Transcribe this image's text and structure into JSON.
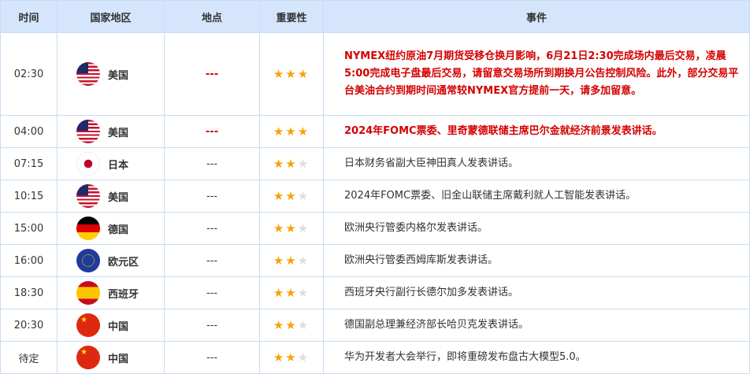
{
  "headers": [
    "时间",
    "国家地区",
    "地点",
    "重要性",
    "事件"
  ],
  "rows": [
    {
      "time": "02:30",
      "country": "美国",
      "flag": "us",
      "location": "---",
      "stars": 3,
      "important": true,
      "event": "NYMEX纽约原油7月期货受移仓换月影响，6月21日2:30完成场内最后交易，凌晨5:00完成电子盘最后交易，请留意交易场所到期换月公告控制风险。此外，部分交易平台美油合约到期时间通常较NYMEX官方提前一天，请多加留意。"
    },
    {
      "time": "04:00",
      "country": "美国",
      "flag": "us",
      "location": "---",
      "stars": 3,
      "important": true,
      "event": "2024年FOMC票委、里奇蒙德联储主席巴尔金就经济前景发表讲话。"
    },
    {
      "time": "07:15",
      "country": "日本",
      "flag": "jp",
      "location": "---",
      "stars": 2,
      "important": false,
      "event": "日本财务省副大臣神田真人发表讲话。"
    },
    {
      "time": "10:15",
      "country": "美国",
      "flag": "us",
      "location": "---",
      "stars": 2,
      "important": false,
      "event": "2024年FOMC票委、旧金山联储主席戴利就人工智能发表讲话。"
    },
    {
      "time": "15:00",
      "country": "德国",
      "flag": "de",
      "location": "---",
      "stars": 2,
      "important": false,
      "event": "欧洲央行管委内格尔发表讲话。"
    },
    {
      "time": "16:00",
      "country": "欧元区",
      "flag": "eu",
      "location": "---",
      "stars": 2,
      "important": false,
      "event": "欧洲央行管委西姆库斯发表讲话。"
    },
    {
      "time": "18:30",
      "country": "西班牙",
      "flag": "es",
      "location": "---",
      "stars": 2,
      "important": false,
      "event": "西班牙央行副行长德尔加多发表讲话。"
    },
    {
      "time": "20:30",
      "country": "中国",
      "flag": "cn",
      "location": "---",
      "stars": 2,
      "important": false,
      "event": "德国副总理兼经济部长哈贝克发表讲话。"
    },
    {
      "time": "待定",
      "country": "中国",
      "flag": "cn",
      "location": "---",
      "stars": 2,
      "important": false,
      "event": "华为开发者大会举行，即将重磅发布盘古大模型5.0。"
    }
  ]
}
